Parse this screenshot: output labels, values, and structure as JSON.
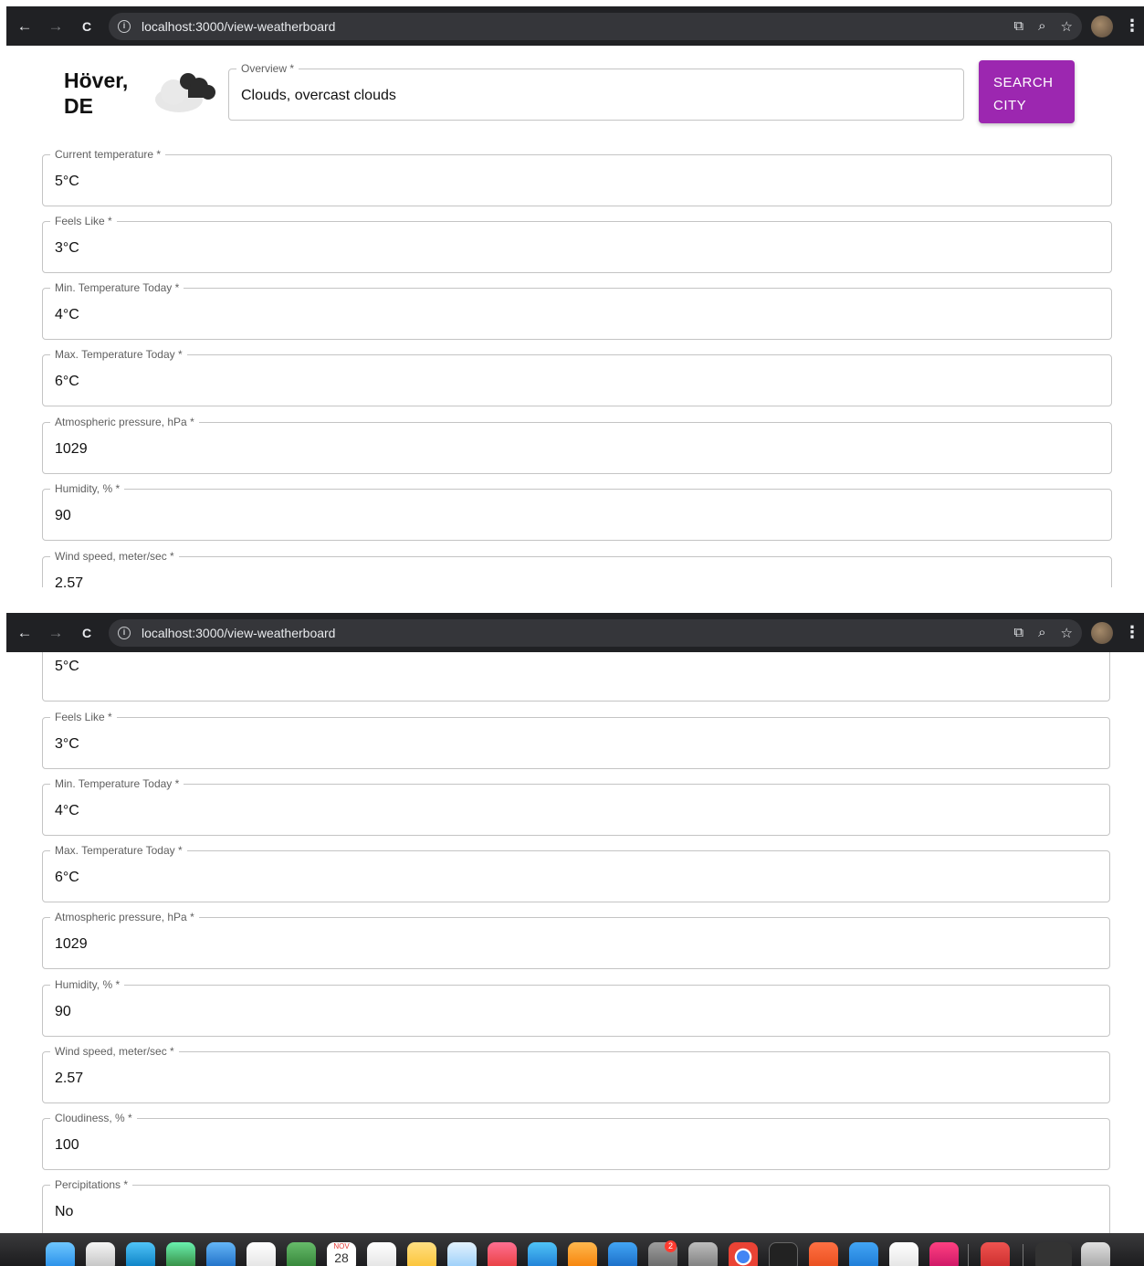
{
  "browser": {
    "url": "localhost:3000/view-weatherboard",
    "back_glyph": "←",
    "forward_glyph": "→",
    "reload_glyph": "C",
    "info_glyph": "i",
    "cast_glyph": "⧉",
    "zoom_glyph": "⌕",
    "star_glyph": "☆",
    "menu_glyph": "⋮"
  },
  "header": {
    "city": "Höver, DE",
    "overview_label": "Overview *",
    "overview_value": "Clouds, overcast clouds",
    "search_button": "SEARCH CITY"
  },
  "fields": [
    {
      "label": "Current temperature *",
      "value": "5°C"
    },
    {
      "label": "Feels Like *",
      "value": "3°C"
    },
    {
      "label": "Min. Temperature Today *",
      "value": "4°C"
    },
    {
      "label": "Max. Temperature Today *",
      "value": "6°C"
    },
    {
      "label": "Atmospheric pressure, hPa *",
      "value": "1029"
    },
    {
      "label": "Humidity, % *",
      "value": "90"
    },
    {
      "label": "Wind speed, meter/sec *",
      "value": "2.57"
    },
    {
      "label": "Cloudiness, % *",
      "value": "100"
    },
    {
      "label": "Percipitations *",
      "value": "No"
    }
  ],
  "dock": {
    "calendar_month": "NOV",
    "calendar_day": "28",
    "badge_count": "2"
  },
  "colors": {
    "accent": "#9c27b0",
    "chrome_bg": "#202124",
    "field_border": "#c4c4c4"
  }
}
